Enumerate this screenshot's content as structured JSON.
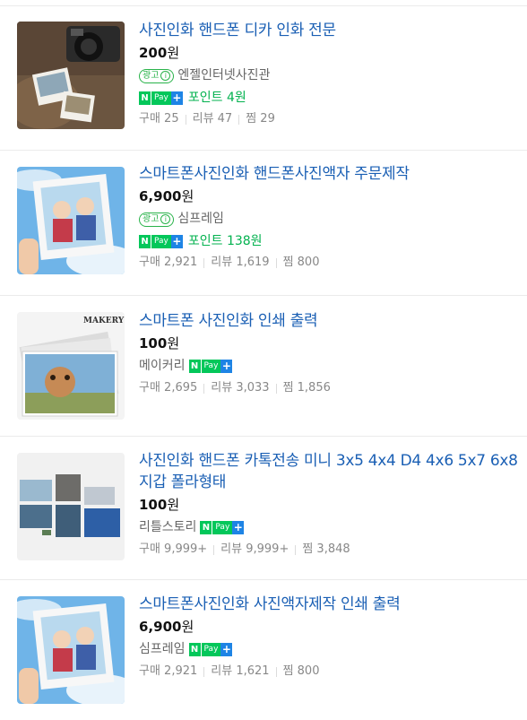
{
  "items": [
    {
      "title": "사진인화 핸드폰 디카 인화 전문",
      "price": "200",
      "won": "원",
      "ad_label": "광고",
      "seller": "엔젤인터넷사진관",
      "npay": {
        "n": "N",
        "pay": "Pay",
        "plus": "+"
      },
      "point": "포인트 4원",
      "stats": {
        "buy": "구매 25",
        "review": "리뷰 47",
        "wish": "찜 29"
      }
    },
    {
      "title": "스마트폰사진인화 핸드폰사진액자 주문제작",
      "price": "6,900",
      "won": "원",
      "ad_label": "광고",
      "seller": "심프레임",
      "npay": {
        "n": "N",
        "pay": "Pay",
        "plus": "+"
      },
      "point": "포인트 138원",
      "stats": {
        "buy": "구매 2,921",
        "review": "리뷰 1,619",
        "wish": "찜 800"
      }
    },
    {
      "title": "스마트폰 사진인화 인쇄 출력",
      "price": "100",
      "won": "원",
      "seller": "메이커리",
      "npay": {
        "n": "N",
        "pay": "Pay",
        "plus": "+"
      },
      "thumb_logo": "MAKERY",
      "stats": {
        "buy": "구매 2,695",
        "review": "리뷰 3,033",
        "wish": "찜 1,856"
      }
    },
    {
      "title": "사진인화 핸드폰 카톡전송 미니 3x5 4x4 D4 4x6 5x7 6x8 지갑 폴라형태",
      "price": "100",
      "won": "원",
      "seller": "리틀스토리",
      "npay": {
        "n": "N",
        "pay": "Pay",
        "plus": "+"
      },
      "stats": {
        "buy": "구매 9,999+",
        "review": "리뷰 9,999+",
        "wish": "찜 3,848"
      }
    },
    {
      "title": "스마트폰사진인화 사진액자제작 인쇄 출력",
      "price": "6,900",
      "won": "원",
      "seller": "심프레임",
      "npay": {
        "n": "N",
        "pay": "Pay",
        "plus": "+"
      },
      "stats": {
        "buy": "구매 2,921",
        "review": "리뷰 1,621",
        "wish": "찜 800"
      }
    }
  ],
  "colors": {
    "title": "#1a5fb4",
    "point": "#03b24f",
    "npay_green": "#03c75a",
    "npay_blue": "#1e84e5"
  }
}
